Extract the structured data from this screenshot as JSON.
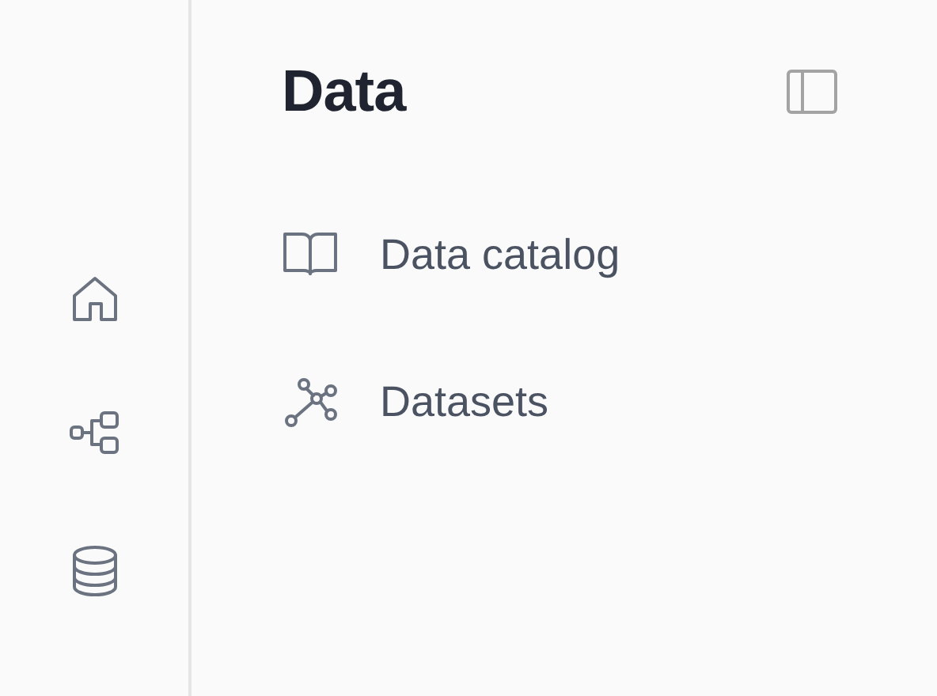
{
  "rail": {
    "items": [
      {
        "kind": "home"
      },
      {
        "kind": "hierarchy"
      },
      {
        "kind": "database"
      }
    ]
  },
  "panel": {
    "title": "Data",
    "items": [
      {
        "kind": "book",
        "label": "Data catalog"
      },
      {
        "kind": "graph",
        "label": "Datasets"
      }
    ]
  }
}
